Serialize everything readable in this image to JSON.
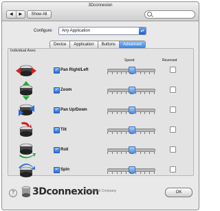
{
  "window": {
    "title": "3Dconnexion"
  },
  "toolbar": {
    "back": "◀",
    "forward": "▶",
    "show_all": "Show All",
    "search_placeholder": ""
  },
  "configure": {
    "label": "Configure:",
    "value": "Any Application"
  },
  "tabs": [
    {
      "label": "Device",
      "active": false
    },
    {
      "label": "Application",
      "active": false
    },
    {
      "label": "Buttons",
      "active": false
    },
    {
      "label": "Advanced",
      "active": true
    }
  ],
  "group": {
    "title": "Individual Axes",
    "speed_header": "Speed",
    "reversed_header": "Reversed"
  },
  "axes": [
    {
      "name": "Pan Right/Left",
      "checked": true,
      "speed": 0.5,
      "reversed": false
    },
    {
      "name": "Zoom",
      "checked": true,
      "speed": 0.5,
      "reversed": false
    },
    {
      "name": "Pan Up/Down",
      "checked": true,
      "speed": 0.5,
      "reversed": false
    },
    {
      "name": "Tilt",
      "checked": true,
      "speed": 0.5,
      "reversed": false
    },
    {
      "name": "Roll",
      "checked": true,
      "speed": 0.5,
      "reversed": false
    },
    {
      "name": "Spin",
      "checked": true,
      "speed": 0.5,
      "reversed": false
    }
  ],
  "footer": {
    "help": "?",
    "brand": "3Dconnexion",
    "company": "A Logitech Company",
    "ok": "OK"
  },
  "colors": {
    "accent": "#3b82e0",
    "arrow_red": "#d42020",
    "arrow_green": "#2da83a",
    "arrow_blue": "#2f6fd0"
  }
}
